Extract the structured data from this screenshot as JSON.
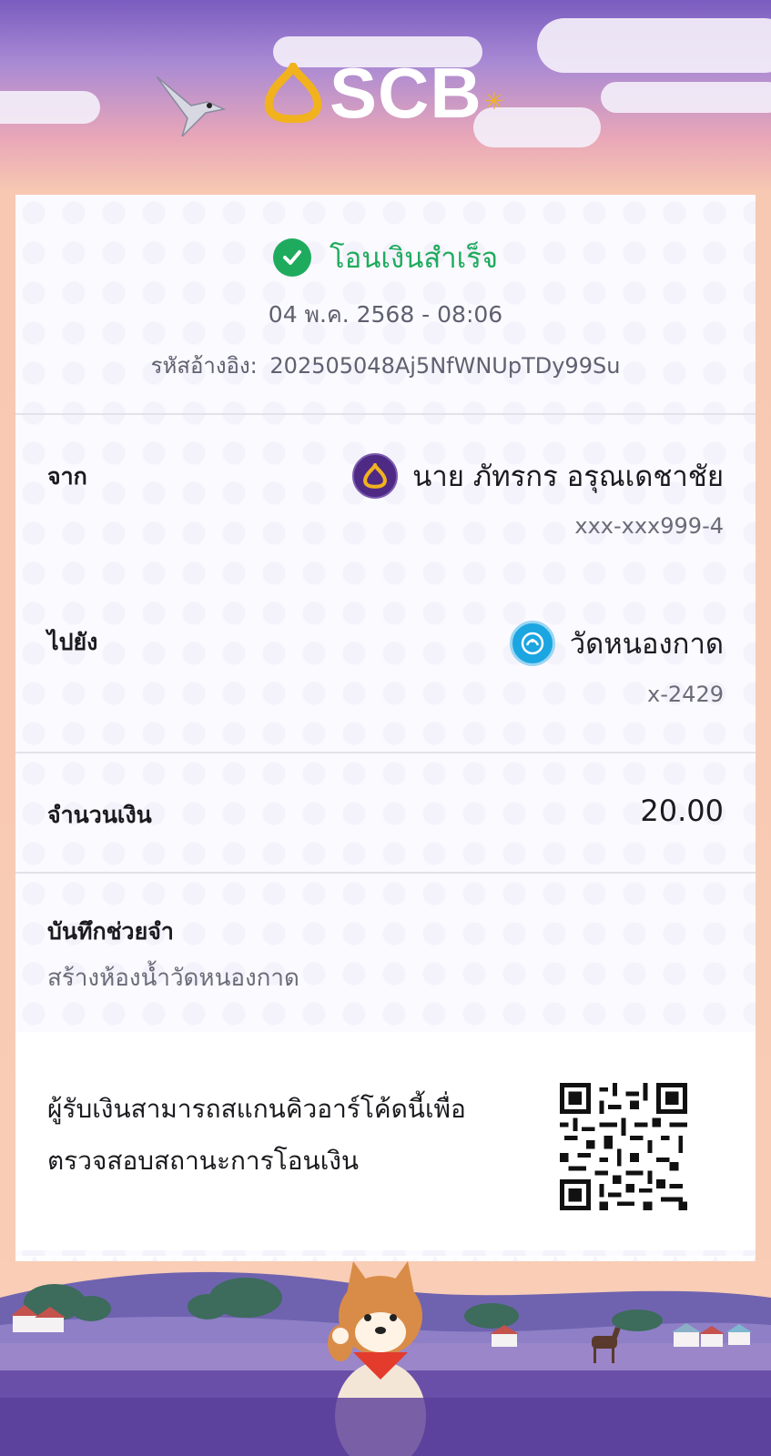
{
  "brand": {
    "name": "SCB",
    "accent": "#4e2a84",
    "logo_gold": "#f1b21e"
  },
  "status": {
    "title": "โอนเงินสำเร็จ",
    "color": "#1fab5e"
  },
  "date": "04 พ.ค. 2568 - 08:06",
  "reference": {
    "label": "รหัสอ้างอิง:",
    "value": "202505048Aj5NfWNUpTDy99Su"
  },
  "from": {
    "label": "จาก",
    "name": "นาย ภัทรกร อรุณเดชาชัย",
    "account": "xxx-xxx999-4",
    "bank_icon": "scb-bank-icon"
  },
  "to": {
    "label": "ไปยัง",
    "name": "วัดหนองกาด",
    "account": "x-2429",
    "bank_icon": "ktb-bank-icon"
  },
  "amount": {
    "label": "จำนวนเงิน",
    "value": "20.00"
  },
  "memo": {
    "label": "บันทึกช่วยจำ",
    "value": "สร้างห้องน้ำวัดหนองกาด"
  },
  "qr": {
    "text": "ผู้รับเงินสามารถสแกนคิวอาร์โค้ดนี้เพื่อตรวจสอบสถานะการโอนเงิน",
    "icon": "qr-code-icon"
  }
}
